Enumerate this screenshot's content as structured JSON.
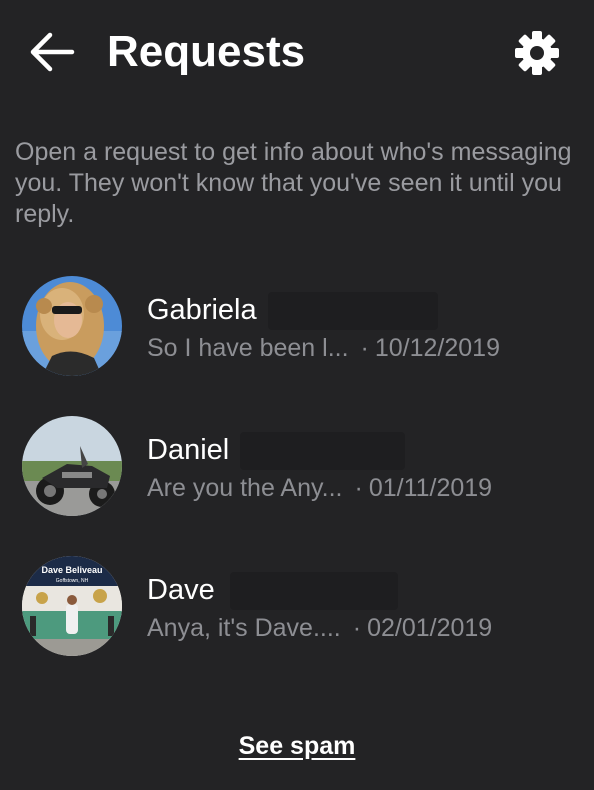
{
  "header": {
    "title": "Requests",
    "back_icon": "arrow-left-icon",
    "settings_icon": "gear-icon"
  },
  "info": {
    "text": "Open a request to get info about who's messaging you. They won't know that you've seen it until you reply."
  },
  "requests": [
    {
      "name": "Gabriela",
      "preview": "So I have been l...",
      "separator": "·",
      "date": "10/12/2019"
    },
    {
      "name": "Daniel",
      "preview": "Are you the Any...",
      "separator": "·",
      "date": "01/11/2019"
    },
    {
      "name": "Dave",
      "preview": "Anya, it's Dave....",
      "separator": "·",
      "date": "02/01/2019"
    }
  ],
  "avatar_texts": {
    "dave_line1": "Dave Beliveau",
    "dave_line2": "Goffstown, NH"
  },
  "footer": {
    "see_spam_label": "See spam"
  },
  "colors": {
    "background": "#232325",
    "text_primary": "#ffffff",
    "text_secondary": "#8d8e93"
  }
}
